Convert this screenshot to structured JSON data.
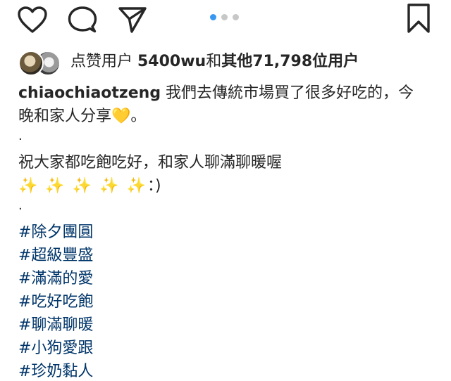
{
  "post": {
    "pager_dots": 3,
    "active_dot": 1,
    "likes": {
      "prefix": "点赞用户 ",
      "liker": "5400wu",
      "joiner": "和",
      "others": "其他71,798位用户"
    },
    "caption": {
      "username": "chiaochiaotzeng",
      "line1_text": " 我們去傳統市場買了很多好吃的，今",
      "line2_text": "晚和家人分享",
      "line2_emoji": "💛",
      "line2_end": "。",
      "dot1": "·",
      "line3": "祝大家都吃飽吃好，和家人聊滿聊暖喔",
      "line4_emoji": "✨ ✨ ✨ ✨ ✨",
      "line4_end": "：)",
      "dot2": "·",
      "hashtags": [
        "#除夕團圓",
        "#超級豐盛",
        "#滿滿的愛",
        "#吃好吃飽",
        "#聊滿聊暖",
        "#小狗愛跟",
        "#珍奶黏人"
      ]
    }
  },
  "icons": {
    "like": "heart-icon",
    "comment": "comment-icon",
    "share": "paper-plane-icon",
    "save": "bookmark-icon"
  },
  "colors": {
    "text": "#262626",
    "hashtag": "#003569",
    "active_dot": "#3897f0",
    "inactive_dot": "#c7c7c7"
  }
}
